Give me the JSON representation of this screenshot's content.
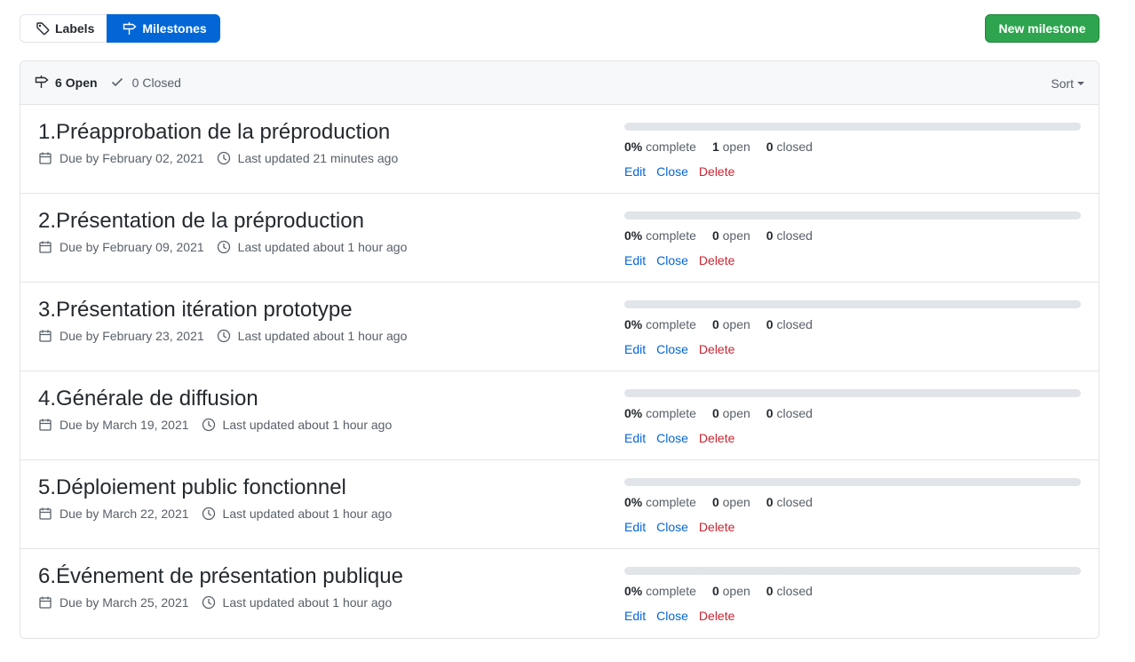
{
  "subnav": {
    "labels_label": "Labels",
    "milestones_label": "Milestones",
    "new_milestone_label": "New milestone"
  },
  "header": {
    "open_count": "6",
    "open_label": "Open",
    "closed_count": "0",
    "closed_label": "Closed",
    "sort_label": "Sort"
  },
  "milestones": [
    {
      "title": "1.Préapprobation de la préproduction",
      "due": "Due by February 02, 2021",
      "updated": "Last updated 21 minutes ago",
      "percent": "0%",
      "percent_value": 0,
      "complete_label": "complete",
      "open": "1",
      "open_label": "open",
      "closed": "0",
      "closed_label": "closed",
      "edit": "Edit",
      "close": "Close",
      "delete": "Delete"
    },
    {
      "title": "2.Présentation de la préproduction",
      "due": "Due by February 09, 2021",
      "updated": "Last updated about 1 hour ago",
      "percent": "0%",
      "percent_value": 0,
      "complete_label": "complete",
      "open": "0",
      "open_label": "open",
      "closed": "0",
      "closed_label": "closed",
      "edit": "Edit",
      "close": "Close",
      "delete": "Delete"
    },
    {
      "title": "3.Présentation itération prototype",
      "due": "Due by February 23, 2021",
      "updated": "Last updated about 1 hour ago",
      "percent": "0%",
      "percent_value": 0,
      "complete_label": "complete",
      "open": "0",
      "open_label": "open",
      "closed": "0",
      "closed_label": "closed",
      "edit": "Edit",
      "close": "Close",
      "delete": "Delete"
    },
    {
      "title": "4.Générale de diffusion",
      "due": "Due by March 19, 2021",
      "updated": "Last updated about 1 hour ago",
      "percent": "0%",
      "percent_value": 0,
      "complete_label": "complete",
      "open": "0",
      "open_label": "open",
      "closed": "0",
      "closed_label": "closed",
      "edit": "Edit",
      "close": "Close",
      "delete": "Delete"
    },
    {
      "title": "5.Déploiement public fonctionnel",
      "due": "Due by March 22, 2021",
      "updated": "Last updated about 1 hour ago",
      "percent": "0%",
      "percent_value": 0,
      "complete_label": "complete",
      "open": "0",
      "open_label": "open",
      "closed": "0",
      "closed_label": "closed",
      "edit": "Edit",
      "close": "Close",
      "delete": "Delete"
    },
    {
      "title": "6.Événement de présentation publique",
      "due": "Due by March 25, 2021",
      "updated": "Last updated about 1 hour ago",
      "percent": "0%",
      "percent_value": 0,
      "complete_label": "complete",
      "open": "0",
      "open_label": "open",
      "closed": "0",
      "closed_label": "closed",
      "edit": "Edit",
      "close": "Close",
      "delete": "Delete"
    }
  ],
  "colors": {
    "accent": "#0366d6",
    "primary_button": "#2ea44f",
    "danger": "#cb2431",
    "muted": "#586069",
    "border": "#e1e4e8"
  },
  "icons": {
    "labels": "tag-icon",
    "milestones": "milestone-icon",
    "open": "milestone-icon",
    "closed": "check-icon",
    "due": "calendar-icon",
    "updated": "clock-icon",
    "sort": "triangle-down-icon"
  }
}
